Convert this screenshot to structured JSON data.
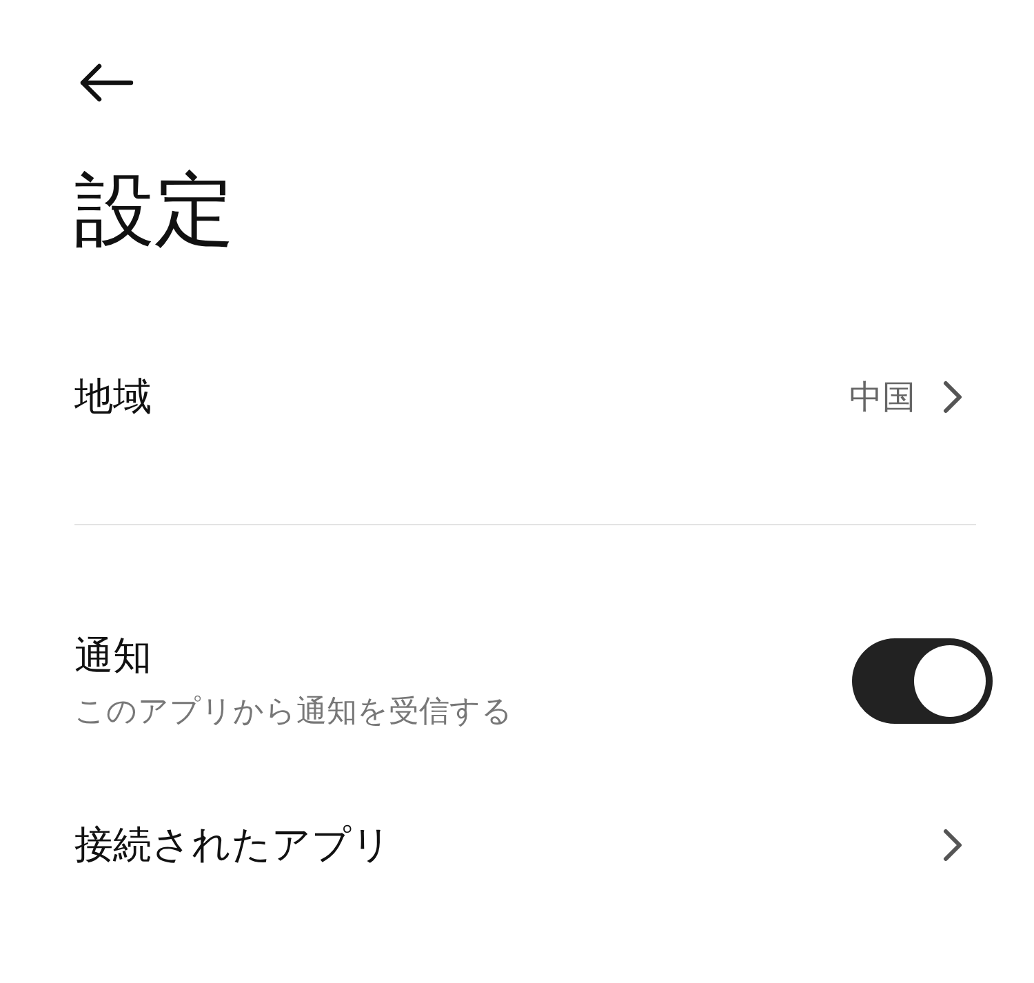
{
  "title": "設定",
  "rows": [
    {
      "kind": "link",
      "label": "地域",
      "value": "中国",
      "divider_after": true
    },
    {
      "kind": "toggle",
      "label": "通知",
      "subtitle": "このアプリから通知を受信する",
      "on": true
    },
    {
      "kind": "link",
      "label": "接続されたアプリ"
    }
  ]
}
